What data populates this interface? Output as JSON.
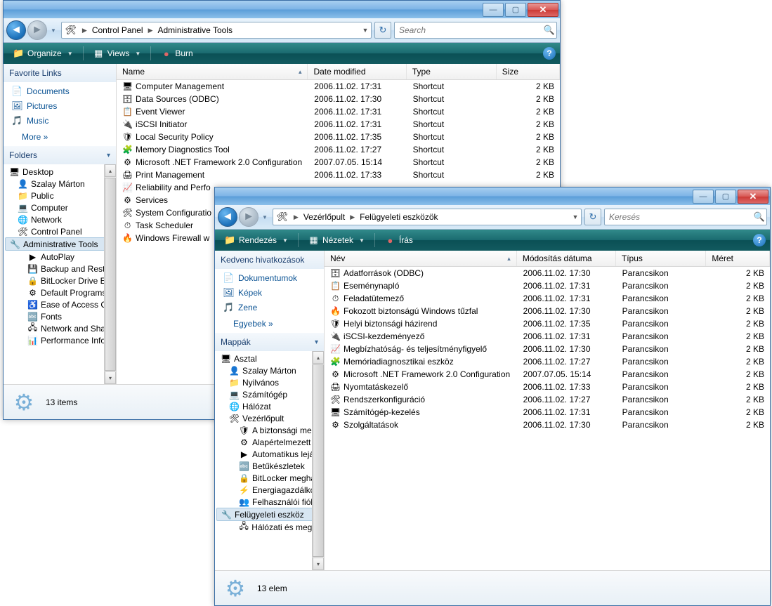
{
  "w1": {
    "breadcrumbs": [
      "Control Panel",
      "Administrative Tools"
    ],
    "search_placeholder": "Search",
    "cmdbar": {
      "organize": "Organize",
      "views": "Views",
      "burn": "Burn"
    },
    "fav_header": "Favorite Links",
    "favorites": [
      {
        "icon": "📄",
        "label": "Documents"
      },
      {
        "icon": "🖼",
        "label": "Pictures"
      },
      {
        "icon": "🎵",
        "label": "Music"
      }
    ],
    "more": "More  »",
    "folders_header": "Folders",
    "tree": [
      {
        "lvl": 0,
        "icon": "🖥",
        "label": "Desktop"
      },
      {
        "lvl": 1,
        "icon": "👤",
        "label": "Szalay Márton"
      },
      {
        "lvl": 1,
        "icon": "📁",
        "label": "Public"
      },
      {
        "lvl": 1,
        "icon": "💻",
        "label": "Computer"
      },
      {
        "lvl": 1,
        "icon": "🌐",
        "label": "Network"
      },
      {
        "lvl": 1,
        "icon": "🛠",
        "label": "Control Panel"
      },
      {
        "lvl": 2,
        "icon": "🔧",
        "label": "Administrative Tools",
        "sel": true
      },
      {
        "lvl": 2,
        "icon": "▶",
        "label": "AutoPlay"
      },
      {
        "lvl": 2,
        "icon": "💾",
        "label": "Backup and Restore"
      },
      {
        "lvl": 2,
        "icon": "🔒",
        "label": "BitLocker Drive Enc"
      },
      {
        "lvl": 2,
        "icon": "⚙",
        "label": "Default Programs"
      },
      {
        "lvl": 2,
        "icon": "♿",
        "label": "Ease of Access Cen"
      },
      {
        "lvl": 2,
        "icon": "🔤",
        "label": "Fonts"
      },
      {
        "lvl": 2,
        "icon": "🖧",
        "label": "Network and Shari"
      },
      {
        "lvl": 2,
        "icon": "📊",
        "label": "Performance Infor"
      }
    ],
    "columns": {
      "name": "Name",
      "date": "Date modified",
      "type": "Type",
      "size": "Size"
    },
    "rows": [
      {
        "icon": "🖥",
        "name": "Computer Management",
        "date": "2006.11.02. 17:31",
        "type": "Shortcut",
        "size": "2 KB"
      },
      {
        "icon": "🗄",
        "name": "Data Sources (ODBC)",
        "date": "2006.11.02. 17:30",
        "type": "Shortcut",
        "size": "2 KB"
      },
      {
        "icon": "📋",
        "name": "Event Viewer",
        "date": "2006.11.02. 17:31",
        "type": "Shortcut",
        "size": "2 KB"
      },
      {
        "icon": "🔌",
        "name": "iSCSI Initiator",
        "date": "2006.11.02. 17:31",
        "type": "Shortcut",
        "size": "2 KB"
      },
      {
        "icon": "🛡",
        "name": "Local Security Policy",
        "date": "2006.11.02. 17:35",
        "type": "Shortcut",
        "size": "2 KB"
      },
      {
        "icon": "🧩",
        "name": "Memory Diagnostics Tool",
        "date": "2006.11.02. 17:27",
        "type": "Shortcut",
        "size": "2 KB"
      },
      {
        "icon": "⚙",
        "name": "Microsoft .NET Framework 2.0 Configuration",
        "date": "2007.07.05. 15:14",
        "type": "Shortcut",
        "size": "2 KB"
      },
      {
        "icon": "🖨",
        "name": "Print Management",
        "date": "2006.11.02. 17:33",
        "type": "Shortcut",
        "size": "2 KB"
      },
      {
        "icon": "📈",
        "name": "Reliability and Perfo",
        "date": "",
        "type": "",
        "size": ""
      },
      {
        "icon": "⚙",
        "name": "Services",
        "date": "",
        "type": "",
        "size": ""
      },
      {
        "icon": "🛠",
        "name": "System Configuratio",
        "date": "",
        "type": "",
        "size": ""
      },
      {
        "icon": "⏱",
        "name": "Task Scheduler",
        "date": "",
        "type": "",
        "size": ""
      },
      {
        "icon": "🔥",
        "name": "Windows Firewall w",
        "date": "",
        "type": "",
        "size": ""
      }
    ],
    "status": "13 items"
  },
  "w2": {
    "breadcrumbs": [
      "Vezérlőpult",
      "Felügyeleti eszközök"
    ],
    "search_placeholder": "Keresés",
    "cmdbar": {
      "organize": "Rendezés",
      "views": "Nézetek",
      "burn": "Írás"
    },
    "fav_header": "Kedvenc hivatkozások",
    "favorites": [
      {
        "icon": "📄",
        "label": "Dokumentumok"
      },
      {
        "icon": "🖼",
        "label": "Képek"
      },
      {
        "icon": "🎵",
        "label": "Zene"
      }
    ],
    "more": "Egyebek  »",
    "folders_header": "Mappák",
    "tree": [
      {
        "lvl": 0,
        "icon": "🖥",
        "label": "Asztal"
      },
      {
        "lvl": 1,
        "icon": "👤",
        "label": "Szalay Márton"
      },
      {
        "lvl": 1,
        "icon": "📁",
        "label": "Nyilvános"
      },
      {
        "lvl": 1,
        "icon": "💻",
        "label": "Számítógép"
      },
      {
        "lvl": 1,
        "icon": "🌐",
        "label": "Hálózat"
      },
      {
        "lvl": 1,
        "icon": "🛠",
        "label": "Vezérlőpult"
      },
      {
        "lvl": 2,
        "icon": "🛡",
        "label": "A biztonsági ment"
      },
      {
        "lvl": 2,
        "icon": "⚙",
        "label": "Alapértelmezett pr"
      },
      {
        "lvl": 2,
        "icon": "▶",
        "label": "Automatikus leját"
      },
      {
        "lvl": 2,
        "icon": "🔤",
        "label": "Betűkészletek"
      },
      {
        "lvl": 2,
        "icon": "🔒",
        "label": "BitLocker meghajt"
      },
      {
        "lvl": 2,
        "icon": "⚡",
        "label": "Energiagazdálkodá"
      },
      {
        "lvl": 2,
        "icon": "👥",
        "label": "Felhasználói fióko"
      },
      {
        "lvl": 2,
        "icon": "🔧",
        "label": "Felügyeleti eszköz",
        "sel": true
      },
      {
        "lvl": 2,
        "icon": "🖧",
        "label": "Hálózati és megos"
      }
    ],
    "columns": {
      "name": "Név",
      "date": "Módosítás dátuma",
      "type": "Típus",
      "size": "Méret"
    },
    "rows": [
      {
        "icon": "🗄",
        "name": "Adatforrások (ODBC)",
        "date": "2006.11.02. 17:30",
        "type": "Parancsikon",
        "size": "2 KB"
      },
      {
        "icon": "📋",
        "name": "Eseménynapló",
        "date": "2006.11.02. 17:31",
        "type": "Parancsikon",
        "size": "2 KB"
      },
      {
        "icon": "⏱",
        "name": "Feladatütemező",
        "date": "2006.11.02. 17:31",
        "type": "Parancsikon",
        "size": "2 KB"
      },
      {
        "icon": "🔥",
        "name": "Fokozott biztonságú Windows tűzfal",
        "date": "2006.11.02. 17:30",
        "type": "Parancsikon",
        "size": "2 KB"
      },
      {
        "icon": "🛡",
        "name": "Helyi biztonsági házirend",
        "date": "2006.11.02. 17:35",
        "type": "Parancsikon",
        "size": "2 KB"
      },
      {
        "icon": "🔌",
        "name": "iSCSI-kezdeményező",
        "date": "2006.11.02. 17:31",
        "type": "Parancsikon",
        "size": "2 KB"
      },
      {
        "icon": "📈",
        "name": "Megbízhatóság- és teljesítményfigyelő",
        "date": "2006.11.02. 17:30",
        "type": "Parancsikon",
        "size": "2 KB"
      },
      {
        "icon": "🧩",
        "name": "Memóriadiagnosztikai eszköz",
        "date": "2006.11.02. 17:27",
        "type": "Parancsikon",
        "size": "2 KB"
      },
      {
        "icon": "⚙",
        "name": "Microsoft .NET Framework 2.0 Configuration",
        "date": "2007.07.05. 15:14",
        "type": "Parancsikon",
        "size": "2 KB"
      },
      {
        "icon": "🖨",
        "name": "Nyomtatáskezelő",
        "date": "2006.11.02. 17:33",
        "type": "Parancsikon",
        "size": "2 KB"
      },
      {
        "icon": "🛠",
        "name": "Rendszerkonfiguráció",
        "date": "2006.11.02. 17:27",
        "type": "Parancsikon",
        "size": "2 KB"
      },
      {
        "icon": "🖥",
        "name": "Számítógép-kezelés",
        "date": "2006.11.02. 17:31",
        "type": "Parancsikon",
        "size": "2 KB"
      },
      {
        "icon": "⚙",
        "name": "Szolgáltatások",
        "date": "2006.11.02. 17:30",
        "type": "Parancsikon",
        "size": "2 KB"
      }
    ],
    "status": "13 elem"
  }
}
